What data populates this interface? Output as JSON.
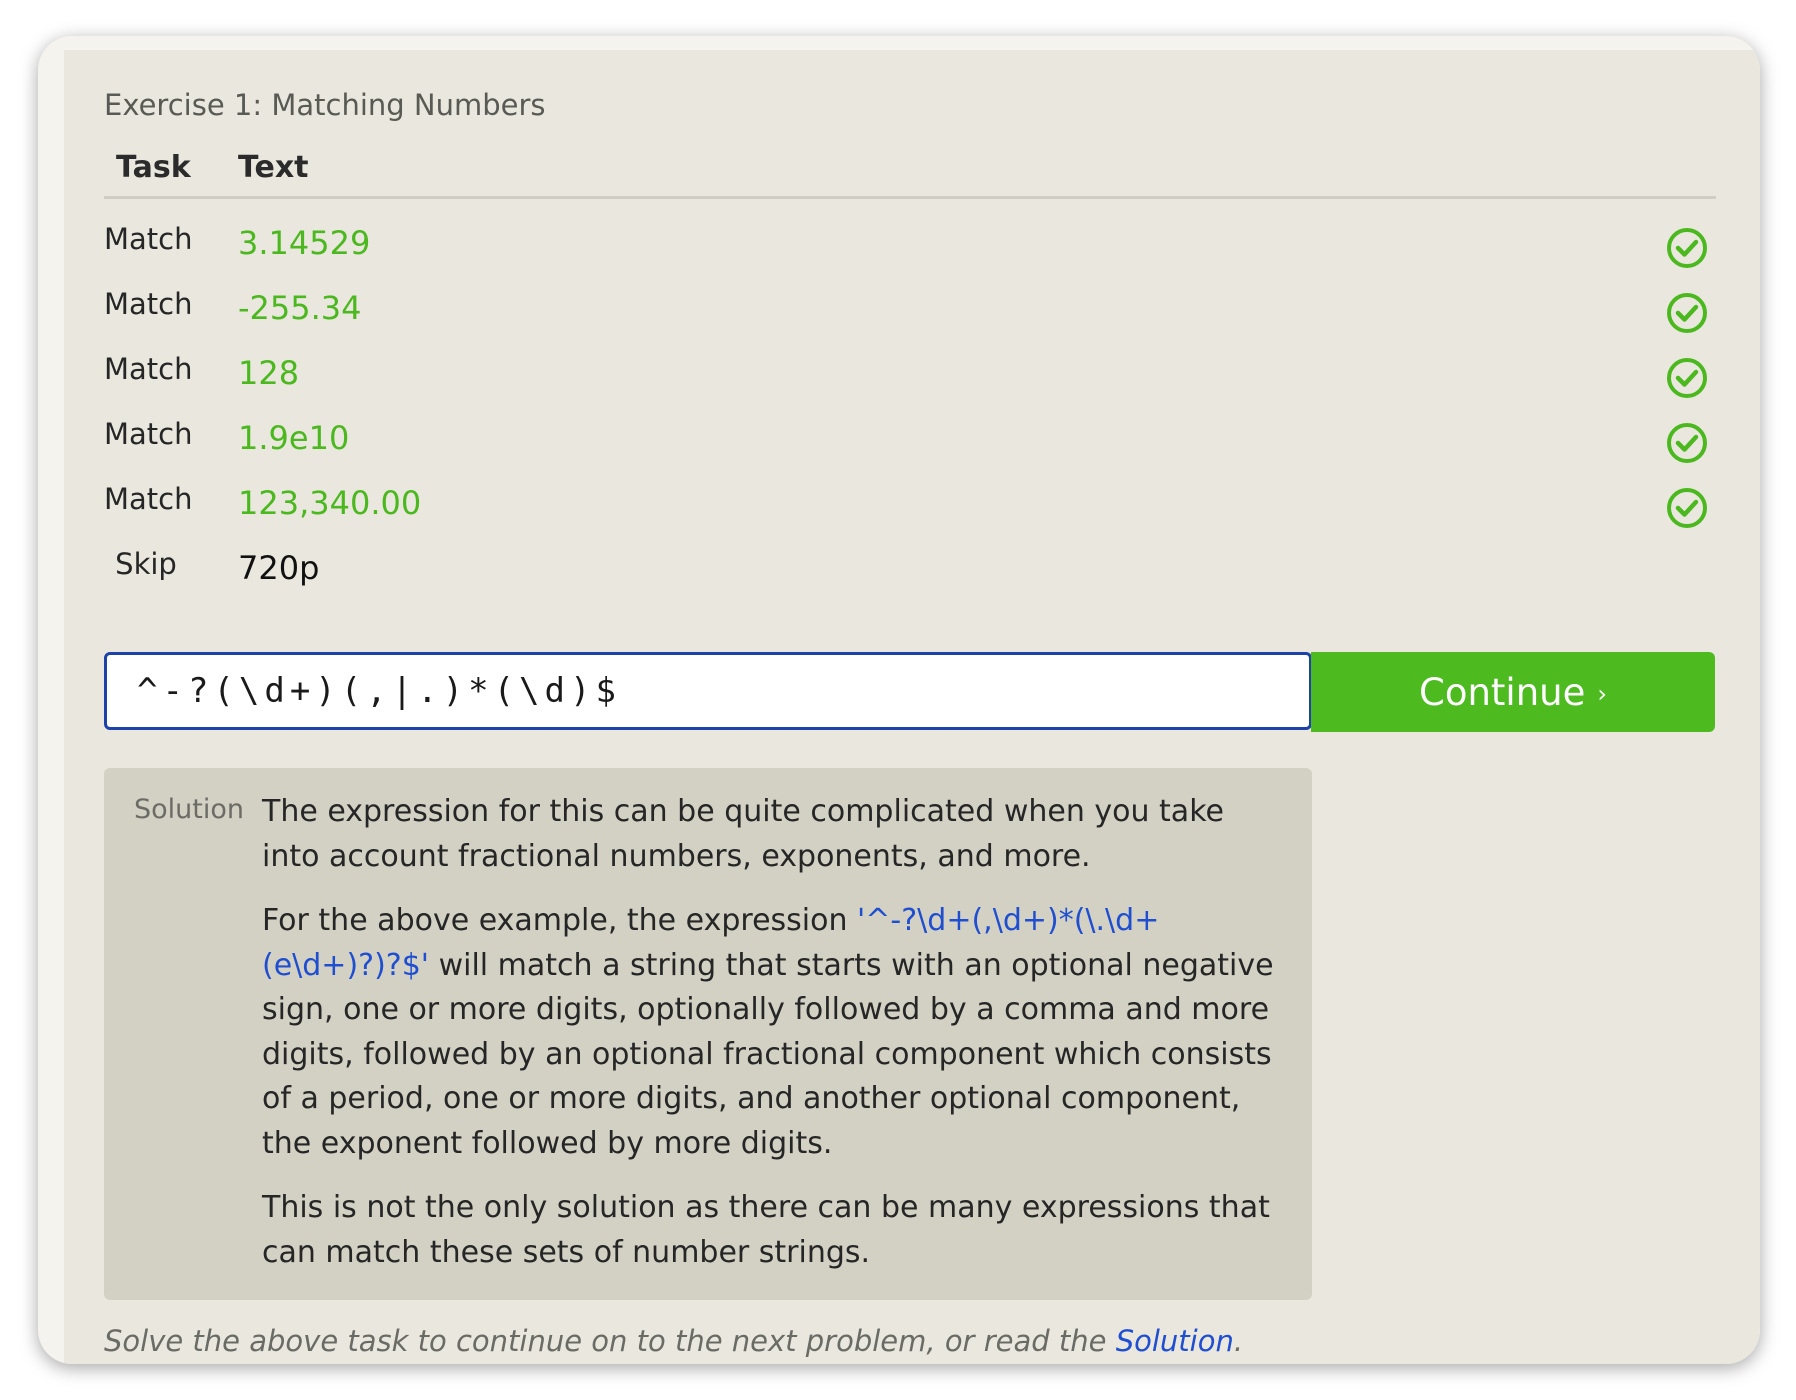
{
  "exercise": {
    "title": "Exercise 1: Matching Numbers"
  },
  "table": {
    "headers": {
      "task": "Task",
      "text": "Text"
    },
    "rows": [
      {
        "task": "Match",
        "text": "3.14529",
        "status": "passed"
      },
      {
        "task": "Match",
        "text": "-255.34",
        "status": "passed"
      },
      {
        "task": "Match",
        "text": "128",
        "status": "passed"
      },
      {
        "task": "Match",
        "text": "1.9e10",
        "status": "passed"
      },
      {
        "task": "Match",
        "text": "123,340.00",
        "status": "passed"
      },
      {
        "task": "Skip",
        "text": "720p",
        "status": "none"
      }
    ]
  },
  "input": {
    "value": "^-?(\\d+)(,|.)*(\\d)$"
  },
  "continue_button": {
    "label": "Continue",
    "chevron": "›"
  },
  "solution": {
    "label": "Solution",
    "p1": "The expression for this can be quite complicated when you take into account fractional numbers, exponents, and more.",
    "p2_before": "For the above example, the expression ",
    "p2_code": "'^-?\\d+(,\\d+)*(\\.\\d+(e\\d+)?)?$'",
    "p2_after": " will match a string that starts with an optional negative sign, one or more digits, optionally followed by a comma and more digits, followed by an optional fractional component which consists of a period, one or more digits, and another optional component, the exponent followed by more digits.",
    "p3": "This is not the only solution as there can be many expressions that can match these sets of number strings."
  },
  "footer": {
    "before": "Solve the above task to continue on to the next problem, or read the ",
    "link": "Solution",
    "after": "."
  },
  "colors": {
    "match_green": "#4cb81f",
    "button_green": "#4dbb20",
    "link_blue": "#1f4fd0",
    "input_border": "#1d43a8",
    "panel_bg": "#eae8de",
    "solution_bg": "#d3d1c4"
  },
  "icons": {
    "passed": "check-circle-icon"
  }
}
